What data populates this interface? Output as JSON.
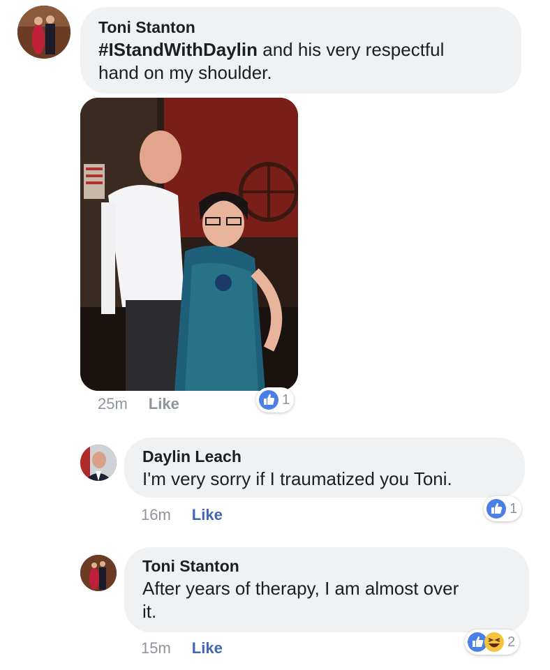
{
  "comments": [
    {
      "author": "Toni Stanton",
      "hashtag": "#IStandWithDaylin",
      "text_after": "and his very respectful",
      "text_line2": "hand on my shoulder.",
      "time": "25m",
      "like_label": "Like",
      "reaction_count": "1",
      "reaction_icons": [
        "like-icon"
      ]
    },
    {
      "author": "Daylin Leach",
      "text": "I'm very sorry if I traumatized you Toni.",
      "time": "16m",
      "like_label": "Like",
      "reaction_count": "1",
      "reaction_icons": [
        "like-icon"
      ]
    },
    {
      "author": "Toni Stanton",
      "text_line1": "After years of therapy, I am almost over",
      "text_line2": "it.",
      "time": "15m",
      "like_label": "Like",
      "reaction_count": "2",
      "reaction_icons": [
        "like-icon",
        "haha-icon"
      ]
    }
  ],
  "colors": {
    "bubble": "#eff1f3",
    "like_blue": "#4267b2",
    "meta_gray": "#8d949e"
  }
}
